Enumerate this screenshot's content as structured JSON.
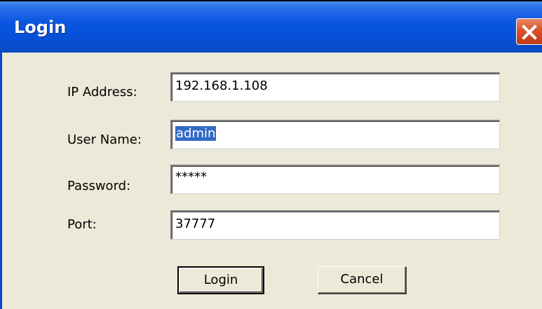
{
  "window": {
    "title": "Login",
    "close_icon": "close-icon"
  },
  "form": {
    "ip_label": "IP Address:",
    "ip_value": "192.168.1.108",
    "user_label": "User Name:",
    "user_value": "admin",
    "password_label": "Password:",
    "password_value": "*****",
    "port_label": "Port:",
    "port_value": "37777"
  },
  "buttons": {
    "login_label": "Login",
    "cancel_label": "Cancel"
  },
  "colors": {
    "titlebar": "#0a56e0",
    "close_button": "#d9522c",
    "dialog_face": "#ece9d8",
    "selection": "#316ac5"
  }
}
